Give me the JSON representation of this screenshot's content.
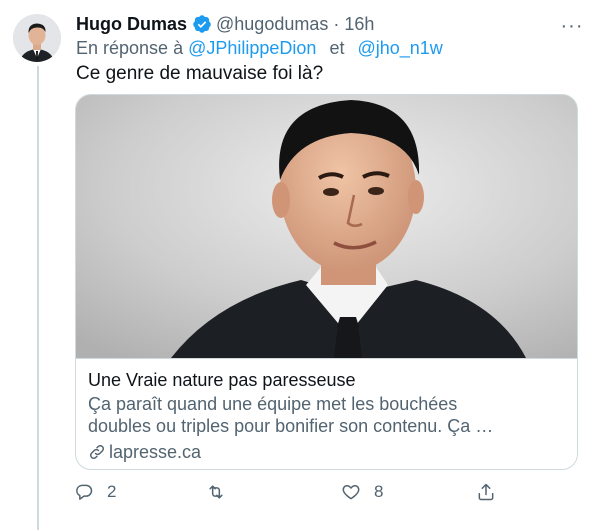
{
  "tweet": {
    "author_name": "Hugo Dumas",
    "handle": "@hugodumas",
    "separator": "·",
    "time": "16h",
    "more_label": "···",
    "reply_prefix": "En réponse à",
    "reply_to_1": "@JPhilippeDion",
    "reply_joiner": "et",
    "reply_to_2": "@jho_n1w",
    "text": "Ce genre de mauvaise foi là?"
  },
  "card": {
    "title": "Une Vraie nature pas paresseuse",
    "description_line1": "Ça paraît quand une équipe met les bouchées",
    "description_line2": "doubles ou triples pour bonifier son contenu. Ça …",
    "domain": "lapresse.ca"
  },
  "actions": {
    "reply_count": "2",
    "retweet_count": "",
    "like_count": "8",
    "share_count": ""
  },
  "colors": {
    "accent": "#1d9bf0",
    "muted": "#536471",
    "border": "#cfd9de"
  }
}
